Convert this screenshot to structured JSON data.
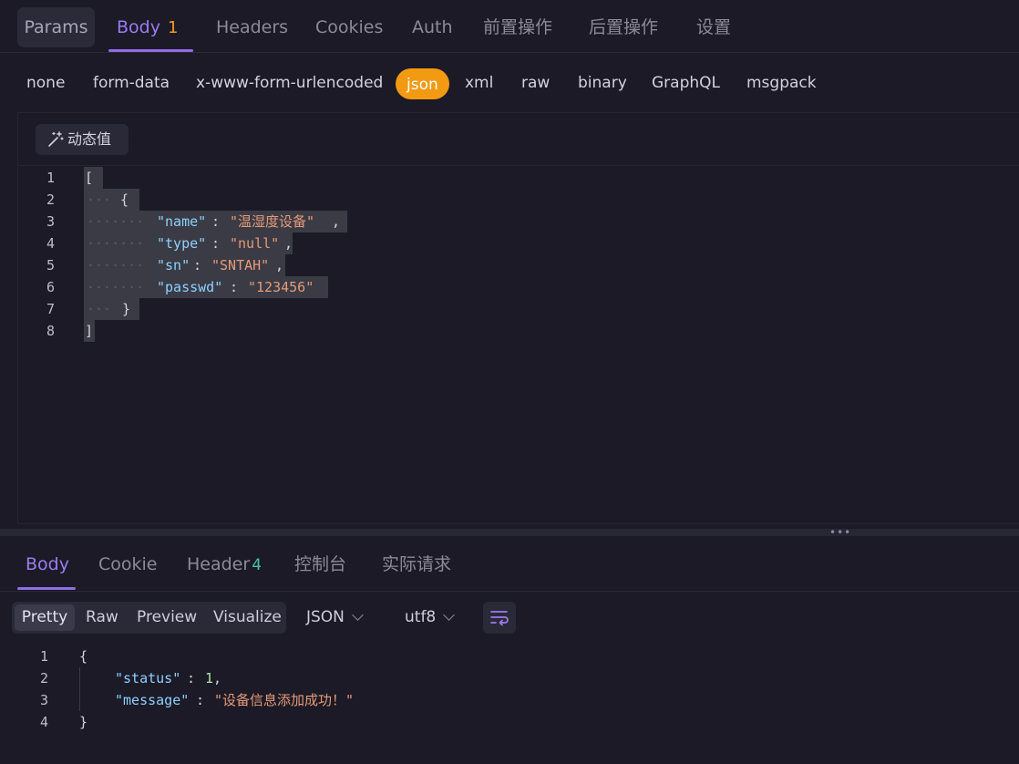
{
  "request_tabs": {
    "params": "Params",
    "body": "Body",
    "body_count": "1",
    "headers": "Headers",
    "cookies": "Cookies",
    "auth": "Auth",
    "pre_ops": "前置操作",
    "post_ops": "后置操作",
    "settings": "设置"
  },
  "body_types": [
    "none",
    "form-data",
    "x-www-form-urlencoded",
    "json",
    "xml",
    "raw",
    "binary",
    "GraphQL",
    "msgpack"
  ],
  "active_body_type": "json",
  "dynamic_value_button": "动态值",
  "request_body": {
    "line_numbers": [
      "1",
      "2",
      "3",
      "4",
      "5",
      "6",
      "7",
      "8"
    ],
    "open_bracket": "[",
    "open_brace": "{",
    "name_key": "\"name\"",
    "name_value": "\"温湿度设备\"",
    "type_key": "\"type\"",
    "type_value": "\"null\"",
    "sn_key": "\"sn\"",
    "sn_value": "\"SNTAH\"",
    "passwd_key": "\"passwd\"",
    "passwd_value": "\"123456\"",
    "close_brace": "}",
    "close_bracket": "]"
  },
  "response_tabs": {
    "body": "Body",
    "cookie": "Cookie",
    "header": "Header",
    "header_count": "4",
    "console": "控制台",
    "actual_request": "实际请求"
  },
  "view_modes": [
    "Pretty",
    "Raw",
    "Preview",
    "Visualize"
  ],
  "active_view_mode": "Pretty",
  "format_select": "JSON",
  "encoding_select": "utf8",
  "wrap_icon": "word-wrap-icon",
  "response_body": {
    "line_numbers": [
      "1",
      "2",
      "3",
      "4"
    ],
    "open_brace": "{",
    "status_key": "\"status\"",
    "status_value": "1",
    "message_key": "\"message\"",
    "message_value": "\"设备信息添加成功！\"",
    "close_brace": "}"
  },
  "colors": {
    "accent": "#8f6ee6",
    "active_pill": "#f29a12",
    "background": "#1b1a26",
    "json_key": "#8fd0ff",
    "json_string": "#e59a78"
  }
}
